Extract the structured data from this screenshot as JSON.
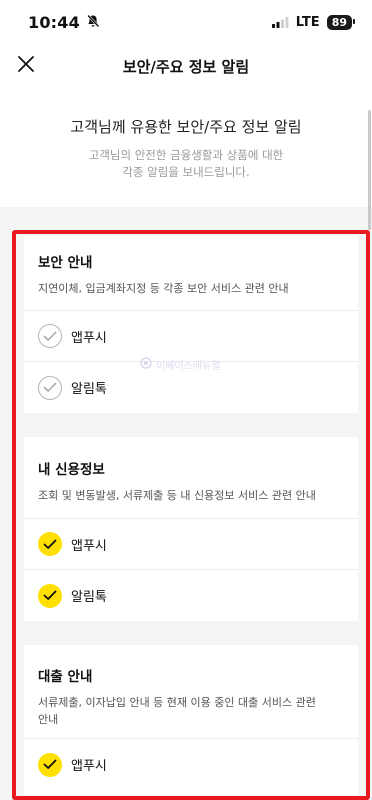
{
  "status": {
    "time": "10:44",
    "network": "LTE",
    "battery": "89"
  },
  "nav": {
    "title": "보안/주요 정보 알림"
  },
  "intro": {
    "title": "고객님께 유용한 보안/주요 정보 알림",
    "desc_line1": "고객님의 안전한 금융생활과 상품에 대한",
    "desc_line2": "각종 알림을 보내드립니다."
  },
  "sections": [
    {
      "title": "보안 안내",
      "desc": "지연이체, 입금계좌지정 등 각종 보안 서비스 관련 안내",
      "options": [
        {
          "label": "앱푸시",
          "checked": false
        },
        {
          "label": "알림톡",
          "checked": false
        }
      ]
    },
    {
      "title": "내 신용정보",
      "desc": "조회 및 변동발생, 서류제출 등 내 신용정보 서비스 관련 안내",
      "options": [
        {
          "label": "앱푸시",
          "checked": true
        },
        {
          "label": "알림톡",
          "checked": true
        }
      ]
    },
    {
      "title": "대출 안내",
      "desc_line1": "서류제출, 이자납입 안내 등 현재 이용 중인 대출 서비스 관련",
      "desc_line2": "안내",
      "options": [
        {
          "label": "앱푸시",
          "checked": true
        }
      ]
    }
  ],
  "watermark": "이베이스매뉴얼",
  "colors": {
    "check_on": "#ffe000",
    "highlight": "#e8191f",
    "background": "#f5f5f5"
  }
}
